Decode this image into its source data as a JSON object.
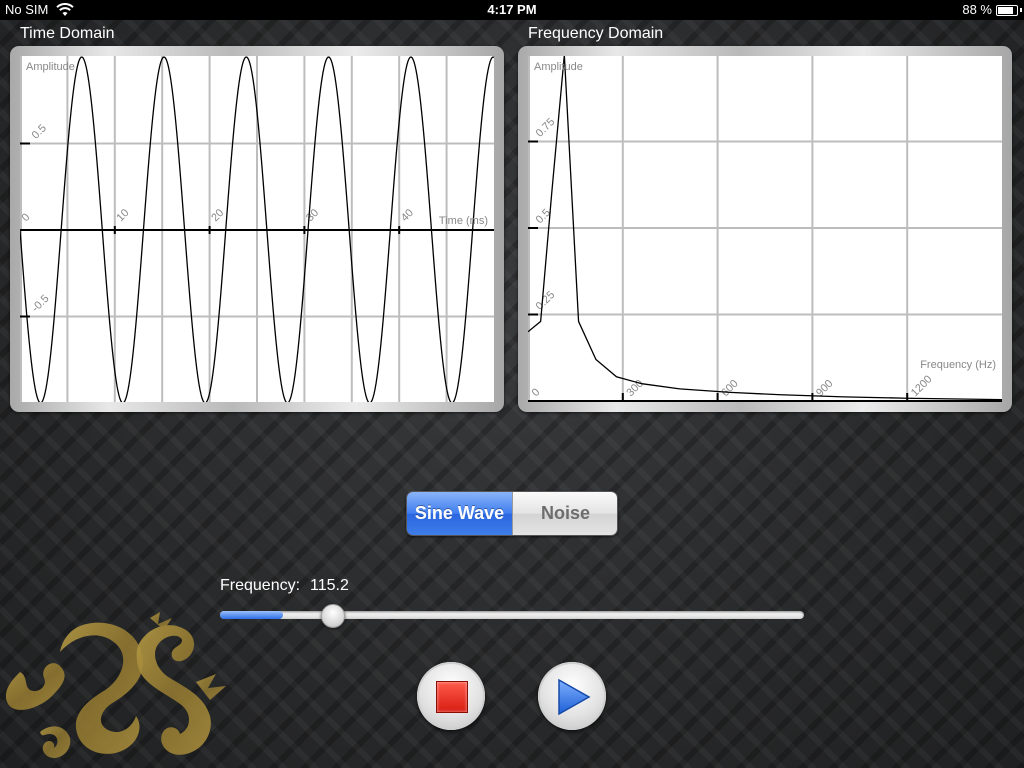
{
  "status_bar": {
    "carrier": "No SIM",
    "time": "4:17 PM",
    "battery_percent": "88 %",
    "battery_level": 0.88,
    "wifi_icon": "wifi-icon",
    "battery_icon": "battery-icon"
  },
  "time_domain": {
    "title": "Time Domain",
    "chart_data": {
      "type": "line",
      "ylabel": "Amplitude",
      "xlabel": "Time (ms)",
      "x_ticks": [
        "0",
        "10",
        "20",
        "30",
        "40"
      ],
      "y_ticks": [
        "0.5",
        "-0.5"
      ],
      "xlim": [
        0,
        50
      ],
      "ylim": [
        -1,
        1
      ],
      "grid": true,
      "series": [
        {
          "frequency_hz": 115.2,
          "amplitude": 1
        }
      ]
    }
  },
  "frequency_domain": {
    "title": "Frequency Domain",
    "chart_data": {
      "type": "line",
      "ylabel": "Amplitude",
      "xlabel": "Frequency (Hz)",
      "x_ticks": [
        "0",
        "300",
        "600",
        "900",
        "1200"
      ],
      "y_ticks": [
        "0.75",
        "0.5",
        "0.25"
      ],
      "xlim": [
        0,
        1500
      ],
      "ylim": [
        0,
        1
      ],
      "grid": true,
      "series": [
        {
          "x": [
            0,
            40,
            75,
            115,
            160,
            215,
            280,
            360,
            480,
            640,
            800,
            1000,
            1200,
            1500
          ],
          "y": [
            0.2,
            0.23,
            0.6,
            1.0,
            0.23,
            0.12,
            0.07,
            0.05,
            0.035,
            0.025,
            0.018,
            0.012,
            0.008,
            0.004
          ]
        }
      ]
    }
  },
  "mode_selector": {
    "options": [
      "Sine Wave",
      "Noise"
    ],
    "selected": "Sine Wave"
  },
  "frequency_control": {
    "label": "Frequency:",
    "value": "115.2",
    "slider_fraction": 0.098
  },
  "controls": {
    "stop_icon": "stop-icon",
    "play_icon": "play-icon"
  },
  "logo": "dragon-logo"
}
